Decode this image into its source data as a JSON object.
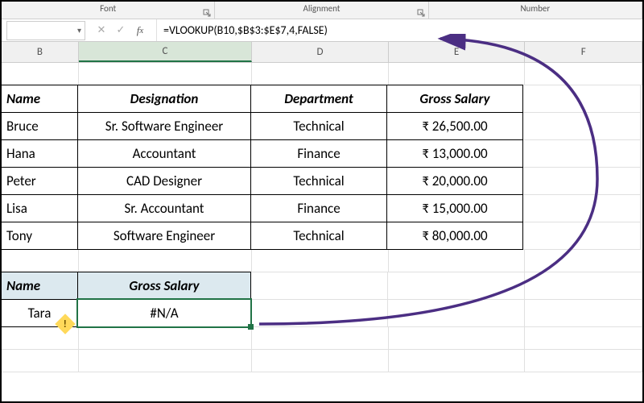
{
  "ribbon": {
    "groups": [
      "Font",
      "Alignment",
      "Number"
    ]
  },
  "formula_bar": {
    "name_box": "",
    "formula": "=VLOOKUP(B10,$B$3:$E$7,4,FALSE)"
  },
  "columns": [
    "B",
    "C",
    "D",
    "E",
    "F"
  ],
  "selected_column": "C",
  "table1": {
    "headers": [
      "Name",
      "Designation",
      "Department",
      "Gross Salary"
    ],
    "rows": [
      [
        "Bruce",
        "Sr. Software Engineer",
        "Technical",
        "₹ 26,500.00"
      ],
      [
        "Hana",
        "Accountant",
        "Finance",
        "₹ 13,000.00"
      ],
      [
        "Peter",
        "CAD Designer",
        "Technical",
        "₹ 20,000.00"
      ],
      [
        "Lisa",
        "Sr. Accountant",
        "Finance",
        "₹ 15,000.00"
      ],
      [
        "Tony",
        "Software Engineer",
        "Technical",
        "₹ 80,000.00"
      ]
    ]
  },
  "lookup": {
    "headers": [
      "Name",
      "Gross Salary"
    ],
    "name": "Tara",
    "result": "#N/A"
  },
  "error_indicator": "!"
}
